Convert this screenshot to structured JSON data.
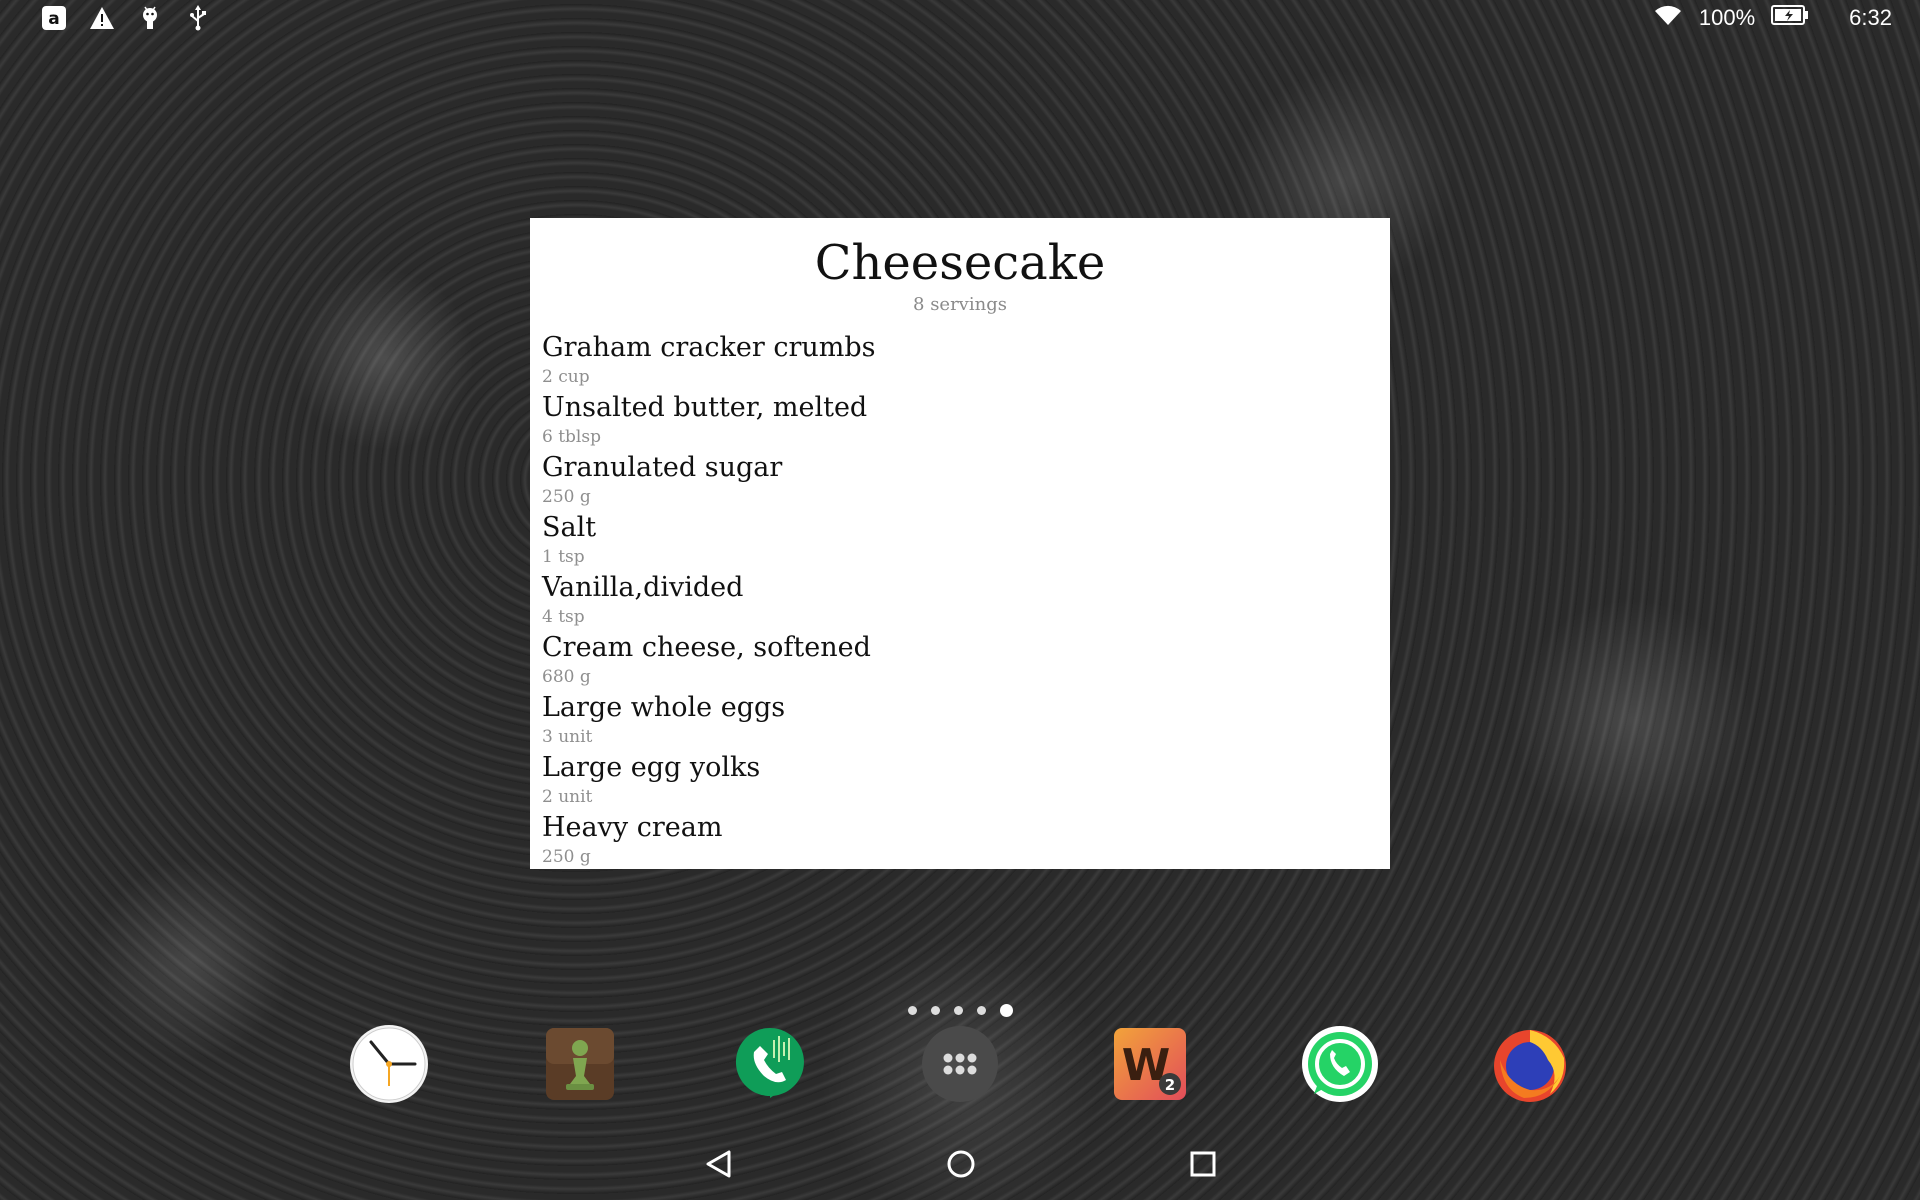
{
  "status_bar": {
    "left_icons": [
      "amazon-icon",
      "warning-icon",
      "android-debug-icon",
      "usb-icon"
    ],
    "battery_percent": "100%",
    "time": "6:32"
  },
  "recipe": {
    "title": "Cheesecake",
    "servings": "8 servings",
    "ingredients": [
      {
        "name": "Graham cracker crumbs",
        "qty": "2 cup"
      },
      {
        "name": "Unsalted butter, melted",
        "qty": "6 tblsp"
      },
      {
        "name": "Granulated sugar",
        "qty": "250 g"
      },
      {
        "name": "Salt",
        "qty": "1 tsp"
      },
      {
        "name": "Vanilla,divided",
        "qty": "4 tsp"
      },
      {
        "name": "Cream cheese, softened",
        "qty": "680 g"
      },
      {
        "name": "Large whole eggs",
        "qty": "3 unit"
      },
      {
        "name": "Large egg yolks",
        "qty": "2 unit"
      },
      {
        "name": "Heavy cream",
        "qty": "250 g"
      }
    ]
  },
  "page_indicator": {
    "count": 5,
    "active_index": 4
  },
  "dock": {
    "apps": [
      "clock-app-icon",
      "chess-app-icon",
      "hangouts-dialer-app-icon",
      "app-drawer-icon",
      "words-with-friends-app-icon",
      "whatsapp-app-icon",
      "firefox-app-icon"
    ],
    "words_badge": "2"
  },
  "nav_bar": {
    "buttons": [
      "back-icon",
      "home-icon",
      "recents-icon"
    ]
  }
}
